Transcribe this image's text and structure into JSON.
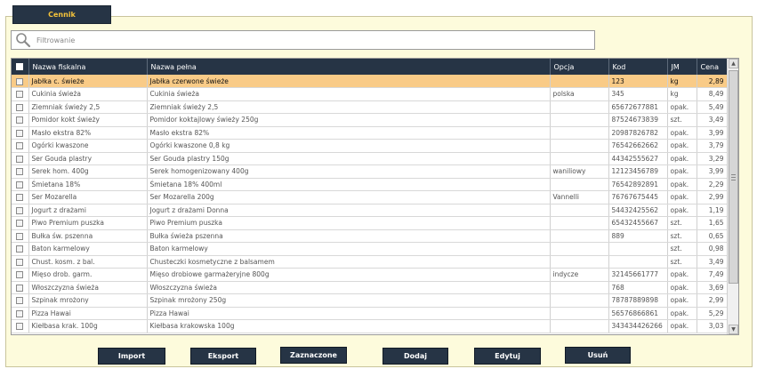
{
  "tab": {
    "label": "Cennik"
  },
  "search": {
    "placeholder": "Filtrowanie",
    "value": ""
  },
  "table": {
    "columns": [
      "Nazwa fiskalna",
      "Nazwa pełna",
      "Opcja",
      "Kod",
      "JM",
      "Cena"
    ],
    "rows": [
      {
        "selected": true,
        "fiscal": "Jabłka c. świeże",
        "full": "Jabłka czerwone świeże",
        "option": "",
        "code": "123",
        "unit": "kg",
        "price": "2,89"
      },
      {
        "selected": false,
        "fiscal": "Cukinia świeża",
        "full": "Cukinia świeża",
        "option": "polska",
        "code": "345",
        "unit": "kg",
        "price": "8,49"
      },
      {
        "selected": false,
        "fiscal": "Ziemniak świeży 2,5",
        "full": "Ziemniak świeży 2,5",
        "option": "",
        "code": "65672677881",
        "unit": "opak.",
        "price": "5,49"
      },
      {
        "selected": false,
        "fiscal": "Pomidor kokt świeży",
        "full": "Pomidor koktajlowy świeży 250g",
        "option": "",
        "code": "87524673839",
        "unit": "szt.",
        "price": "3,49"
      },
      {
        "selected": false,
        "fiscal": "Masło ekstra 82%",
        "full": "Masło ekstra 82%",
        "option": "",
        "code": "20987826782",
        "unit": "opak.",
        "price": "3,99"
      },
      {
        "selected": false,
        "fiscal": "Ogórki kwaszone",
        "full": "Ogórki kwaszone 0,8 kg",
        "option": "",
        "code": "76542662662",
        "unit": "opak.",
        "price": "3,79"
      },
      {
        "selected": false,
        "fiscal": "Ser Gouda plastry",
        "full": "Ser Gouda plastry 150g",
        "option": "",
        "code": "44342555627",
        "unit": "opak.",
        "price": "3,29"
      },
      {
        "selected": false,
        "fiscal": "Serek hom. 400g",
        "full": "Serek homogenizowany 400g",
        "option": "waniliowy",
        "code": "12123456789",
        "unit": "opak.",
        "price": "3,99"
      },
      {
        "selected": false,
        "fiscal": "Śmietana 18%",
        "full": "Śmietana 18% 400ml",
        "option": "",
        "code": "76542892891",
        "unit": "opak.",
        "price": "2,29"
      },
      {
        "selected": false,
        "fiscal": "Ser Mozarella",
        "full": "Ser Mozarella 200g",
        "option": "Vannelli",
        "code": "76767675445",
        "unit": "opak.",
        "price": "2,99"
      },
      {
        "selected": false,
        "fiscal": "Jogurt z drażami",
        "full": "Jogurt z drażami Donna",
        "option": "",
        "code": "54432425562",
        "unit": "opak.",
        "price": "1,19"
      },
      {
        "selected": false,
        "fiscal": "Piwo Premium puszka",
        "full": "Piwo Premium puszka",
        "option": "",
        "code": "65432455667",
        "unit": "szt.",
        "price": "1,65"
      },
      {
        "selected": false,
        "fiscal": "Bułka św. pszenna",
        "full": "Bułka świeża pszenna",
        "option": "",
        "code": "889",
        "unit": "szt.",
        "price": "0,65"
      },
      {
        "selected": false,
        "fiscal": "Baton karmelowy",
        "full": "Baton karmelowy",
        "option": "",
        "code": "",
        "unit": "szt.",
        "price": "0,98"
      },
      {
        "selected": false,
        "fiscal": "Chust. kosm. z bal.",
        "full": "Chusteczki kosmetyczne z balsamem",
        "option": "",
        "code": "",
        "unit": "szt.",
        "price": "3,49"
      },
      {
        "selected": false,
        "fiscal": "Mięso drob. garm.",
        "full": "Mięso drobiowe garmażeryjne 800g",
        "option": "indycze",
        "code": "32145661777",
        "unit": "opak.",
        "price": "7,49"
      },
      {
        "selected": false,
        "fiscal": "Włoszczyzna świeża",
        "full": "Włoszczyzna świeża",
        "option": "",
        "code": "768",
        "unit": "opak.",
        "price": "3,69"
      },
      {
        "selected": false,
        "fiscal": "Szpinak mrożony",
        "full": "Szpinak mrożony 250g",
        "option": "",
        "code": "78787889898",
        "unit": "opak.",
        "price": "2,99"
      },
      {
        "selected": false,
        "fiscal": "Pizza Hawai",
        "full": "Pizza Hawai",
        "option": "",
        "code": "56576866861",
        "unit": "opak.",
        "price": "5,29"
      },
      {
        "selected": false,
        "fiscal": "Kiełbasa krak. 100g",
        "full": "Kiełbasa krakowska 100g",
        "option": "",
        "code": "343434426266",
        "unit": "opak.",
        "price": "3,03"
      }
    ]
  },
  "buttons": [
    "Import",
    "Eksport",
    "Zaznaczone",
    "Dodaj",
    "Edytuj",
    "Usuń"
  ],
  "colors": {
    "header": "#263445",
    "tab_text": "#f5c33a",
    "panel": "#fdfbdc",
    "selected_row": "#f9cb87"
  }
}
